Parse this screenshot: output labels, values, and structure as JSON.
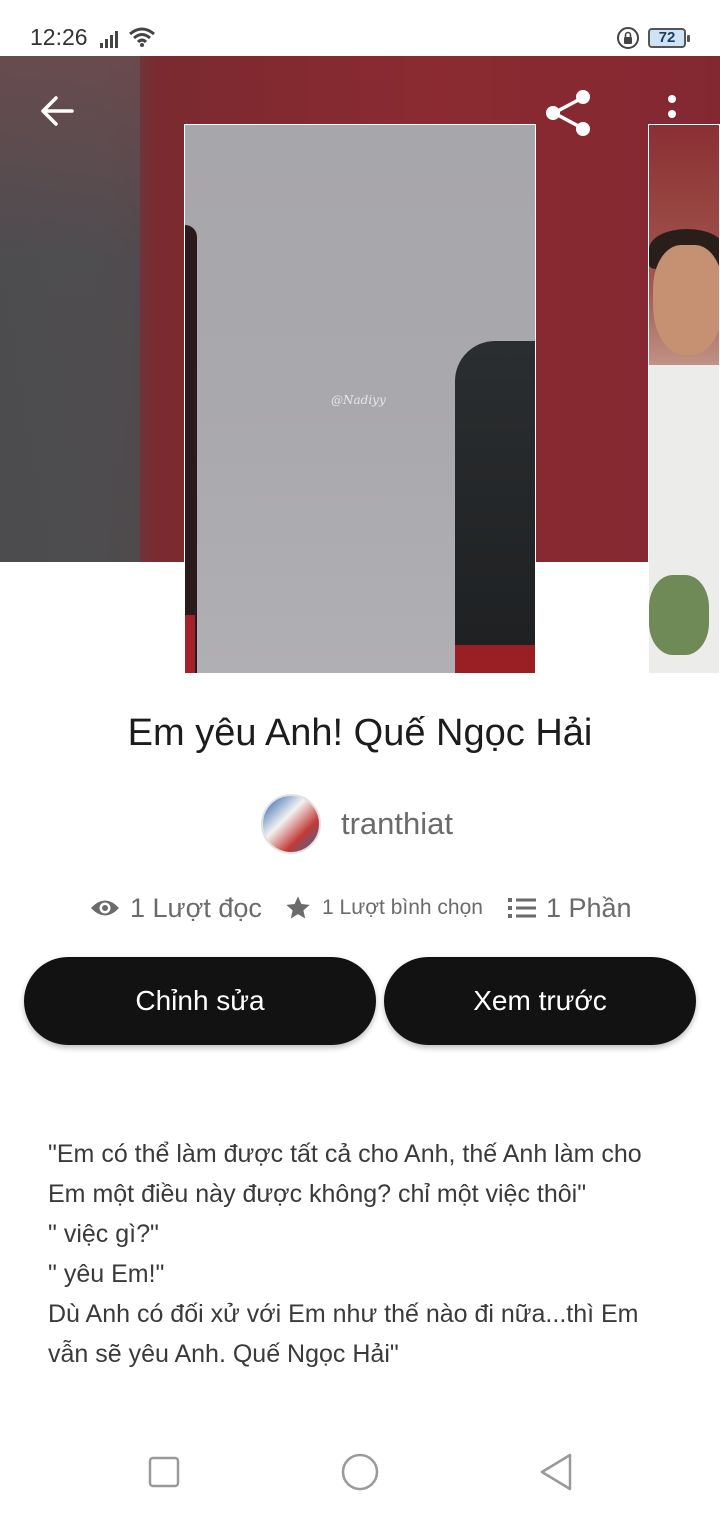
{
  "status_bar": {
    "time": "12:26",
    "battery_level": "72",
    "icons": [
      "signal-icon",
      "wifi-icon",
      "lock-icon",
      "battery-icon"
    ]
  },
  "header": {
    "icons": [
      "back-arrow-icon",
      "share-icon",
      "more-vertical-icon"
    ]
  },
  "cover": {
    "watermark": "@Nadiyy"
  },
  "story": {
    "title": "Em yêu Anh! Quế Ngọc Hải",
    "author": "tranthiat"
  },
  "stats": {
    "reads": "1 Lượt đọc",
    "votes": "1 Lượt bình chọn",
    "parts": "1 Phần",
    "icons": [
      "eye-icon",
      "star-icon",
      "list-icon"
    ]
  },
  "buttons": {
    "edit_label": "Chỉnh sửa",
    "preview_label": "Xem trước"
  },
  "description": {
    "lines": [
      "\"Em có thể làm được tất cả cho Anh, thế Anh làm cho Em một điều này được không? chỉ một việc thôi\"",
      "\" việc gì?\"",
      "\" yêu Em!\"",
      "Dù Anh có đối xử với Em như thế nào đi nữa...thì Em vẫn sẽ yêu Anh. Quế Ngọc Hải\""
    ]
  },
  "nav_bar": {
    "icons": [
      "recent-apps-icon",
      "home-icon",
      "back-icon"
    ]
  },
  "colors": {
    "button_bg": "#121212",
    "hero_red": "#8b2a31",
    "text_secondary": "#6b6b6b"
  }
}
